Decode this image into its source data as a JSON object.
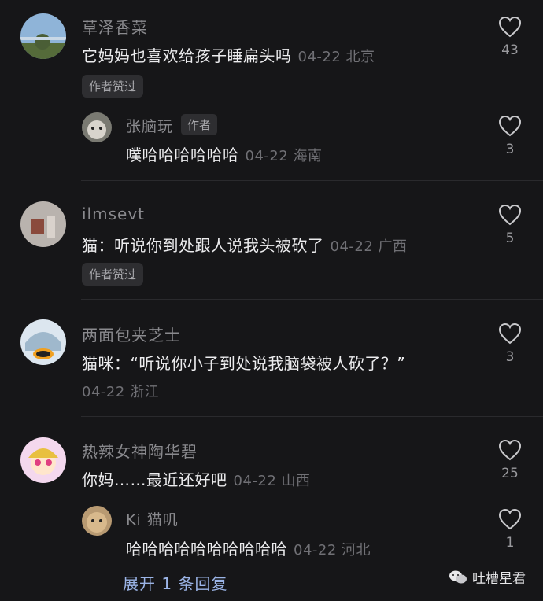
{
  "comments": [
    {
      "user": "草泽香菜",
      "text": "它妈妈也喜欢给孩子睡扁头吗",
      "meta": "04-22 北京",
      "likes": "43",
      "badge": "作者赞过"
    },
    {
      "user": "张脑玩",
      "text": "噗哈哈哈哈哈哈",
      "meta": "04-22 海南",
      "likes": "3",
      "author_tag": "作者"
    },
    {
      "user": "ilmsevt",
      "text": "猫：听说你到处跟人说我头被砍了",
      "meta": "04-22 广西",
      "likes": "5",
      "badge": "作者赞过"
    },
    {
      "user": "两面包夹芝士",
      "text": "猫咪：“听说你小子到处说我脑袋被人砍了？”",
      "meta": "04-22 浙江",
      "likes": "3"
    },
    {
      "user": "热辣女神陶华碧",
      "text": "你妈……最近还好吧",
      "meta": "04-22 山西",
      "likes": "25"
    },
    {
      "user": "Ki 猫叽",
      "text": "哈哈哈哈哈哈哈哈哈哈",
      "meta": "04-22 河北",
      "likes": "1"
    }
  ],
  "expand_label": "展开 1 条回复",
  "watermark": "吐槽星君",
  "colors": {
    "background": "#161618",
    "link": "#9bb4e6"
  }
}
